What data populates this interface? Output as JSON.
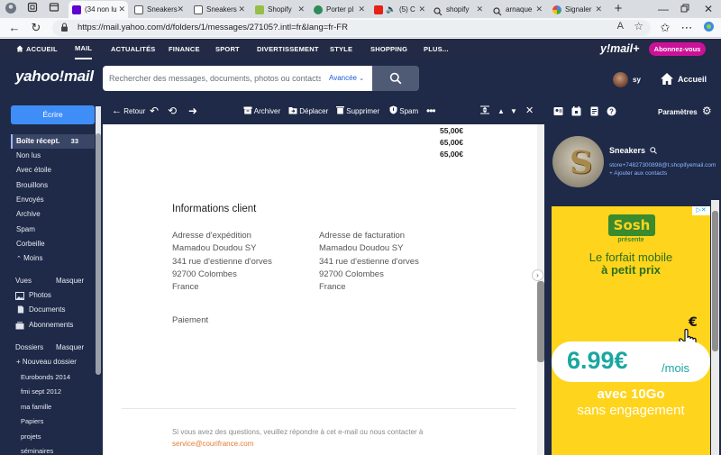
{
  "browser": {
    "tabs": [
      {
        "label": "(34 non lu",
        "active": true
      },
      {
        "label": "Sneakers"
      },
      {
        "label": "Sneakers"
      },
      {
        "label": "Shopify"
      },
      {
        "label": "Porter pl"
      },
      {
        "label": "(5) C"
      },
      {
        "label": "shopify"
      },
      {
        "label": "arnaque"
      },
      {
        "label": "Signaler"
      }
    ],
    "url": "https://mail.yahoo.com/d/folders/1/messages/27105?.intl=fr&lang=fr-FR"
  },
  "topnav": {
    "items": [
      "ACCUEIL",
      "MAIL",
      "ACTUALITÉS",
      "FINANCE",
      "SPORT",
      "DIVERTISSEMENT",
      "STYLE",
      "SHOPPING",
      "PLUS..."
    ],
    "brand": "y!mail+",
    "premium": "Abonnez-vous"
  },
  "header": {
    "logo": "yahoo!mail",
    "search_placeholder": "Rechercher des messages, documents, photos ou contacts",
    "advanced": "Avancée",
    "user": "sy",
    "home": "Accueil"
  },
  "sidebar": {
    "compose": "Écrire",
    "inbox": {
      "label": "Boîte récept.",
      "count": "33"
    },
    "items": [
      "Non lus",
      "Avec étoile",
      "Brouillons",
      "Envoyés",
      "Archive",
      "Spam",
      "Corbeille"
    ],
    "less": "Moins",
    "views_header": "Vues",
    "views_hide": "Masquer",
    "views": [
      "Photos",
      "Documents",
      "Abonnements"
    ],
    "folders_header": "Dossiers",
    "folders_hide": "Masquer",
    "new_folder": "Nouveau dossier",
    "folders": [
      "Eurobonds 2014",
      "fmi sept 2012",
      "ma famille",
      "Papiers",
      "projets",
      "séminaires"
    ]
  },
  "toolbar": {
    "back": "Retour",
    "archive": "Archiver",
    "move": "Déplacer",
    "delete": "Supprimer",
    "spam": "Spam"
  },
  "message": {
    "prices": [
      "55,00€",
      "65,00€",
      "65,00€"
    ],
    "info_title": "Informations client",
    "shipping": {
      "head": "Adresse d'expédition",
      "lines": [
        "Mamadou Doudou SY",
        "341 rue d'estienne d'orves",
        "92700 Colombes",
        "France"
      ]
    },
    "billing": {
      "head": "Adresse de facturation",
      "lines": [
        "Mamadou Doudou SY",
        "341 rue d'estienne d'orves",
        "92700 Colombes",
        "France"
      ]
    },
    "payment": "Paiement",
    "footer_text": "Si vous avez des questions, veuillez répondre à cet e-mail ou nous contacter à",
    "footer_link": "service@courifrance.com"
  },
  "rightpanel": {
    "settings": "Paramètres",
    "contact_name": "Sneakers",
    "contact_email": "store+74827300898@t.shopifyemail.com",
    "add_contact": "+ Ajouter aux contacts"
  },
  "ad": {
    "logo": "Sosh",
    "presente": "présente",
    "line1": "Le forfait mobile",
    "line2": "à petit prix",
    "price": "6.99€",
    "per": "/mois",
    "line3": "avec 10Go",
    "line4": "sans engagement"
  },
  "colors": {
    "nav_bg": "#232a45",
    "panel_bg": "#1e2a48",
    "compose": "#3f8ef8",
    "premium": "#cc1199",
    "ad_yellow": "#ffd41c"
  }
}
